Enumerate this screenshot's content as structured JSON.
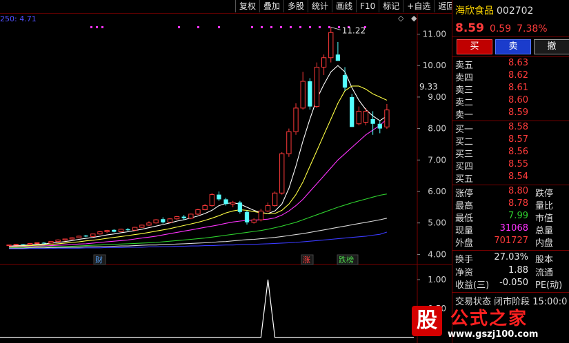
{
  "toolbar": {
    "buttons": [
      "复权",
      "叠加",
      "多股",
      "统计",
      "画线",
      "F10",
      "标记",
      "+自选",
      "返回"
    ]
  },
  "chart": {
    "indicator_label": "250: 4.71",
    "price_axis": [
      "11.00",
      "10.00",
      "9.00",
      "8.00",
      "7.00",
      "6.00",
      "5.00",
      "4.00"
    ],
    "price_axis_values": [
      11,
      10,
      9,
      8,
      7,
      6,
      5,
      4
    ],
    "current_price_tag": "9.33",
    "high_label": "11.22",
    "lower_axis": [
      "1.00",
      "0.50"
    ],
    "event_markers": [
      {
        "text": "财",
        "color": "#5aa8ff"
      },
      {
        "text": "涨",
        "color": "#ff4040"
      },
      {
        "text": "跌榜",
        "color": "#4cd64c"
      }
    ],
    "candles": [
      [
        4.28,
        4.3,
        4.26,
        4.3
      ],
      [
        4.3,
        4.33,
        4.29,
        4.32
      ],
      [
        4.32,
        4.33,
        4.3,
        4.31
      ],
      [
        4.31,
        4.36,
        4.3,
        4.35
      ],
      [
        4.35,
        4.38,
        4.33,
        4.37
      ],
      [
        4.37,
        4.39,
        4.34,
        4.36
      ],
      [
        4.36,
        4.42,
        4.35,
        4.41
      ],
      [
        4.41,
        4.48,
        4.4,
        4.46
      ],
      [
        4.46,
        4.5,
        4.43,
        4.49
      ],
      [
        4.49,
        4.55,
        4.47,
        4.53
      ],
      [
        4.53,
        4.6,
        4.51,
        4.58
      ],
      [
        4.6,
        4.62,
        4.55,
        4.57
      ],
      [
        4.57,
        4.66,
        4.55,
        4.65
      ],
      [
        4.65,
        4.74,
        4.63,
        4.72
      ],
      [
        4.72,
        4.78,
        4.68,
        4.76
      ],
      [
        4.78,
        4.8,
        4.7,
        4.72
      ],
      [
        4.72,
        4.82,
        4.71,
        4.8
      ],
      [
        4.8,
        4.84,
        4.74,
        4.77
      ],
      [
        4.77,
        4.88,
        4.76,
        4.86
      ],
      [
        4.86,
        4.95,
        4.84,
        4.93
      ],
      [
        4.93,
        5.05,
        4.9,
        5.0
      ],
      [
        5.0,
        5.12,
        4.98,
        5.1
      ],
      [
        5.12,
        5.18,
        4.98,
        5.02
      ],
      [
        5.02,
        5.15,
        5.0,
        5.13
      ],
      [
        5.13,
        5.22,
        5.1,
        5.2
      ],
      [
        5.2,
        5.25,
        5.1,
        5.15
      ],
      [
        5.15,
        5.3,
        5.12,
        5.28
      ],
      [
        5.28,
        5.45,
        5.25,
        5.42
      ],
      [
        5.42,
        5.6,
        5.4,
        5.55
      ],
      [
        5.55,
        5.95,
        5.52,
        5.9
      ],
      [
        5.9,
        6.0,
        5.7,
        5.75
      ],
      [
        5.75,
        5.8,
        5.55,
        5.6
      ],
      [
        5.6,
        5.7,
        5.5,
        5.65
      ],
      [
        5.65,
        5.7,
        5.3,
        5.35
      ],
      [
        5.35,
        5.4,
        4.95,
        5.02
      ],
      [
        5.02,
        5.15,
        4.98,
        5.1
      ],
      [
        5.1,
        5.45,
        5.05,
        5.38
      ],
      [
        5.38,
        5.65,
        5.35,
        5.55
      ],
      [
        5.55,
        6.0,
        5.52,
        5.95
      ],
      [
        5.95,
        7.25,
        5.9,
        7.2
      ],
      [
        7.2,
        8.0,
        7.1,
        7.9
      ],
      [
        7.9,
        8.8,
        7.8,
        8.65
      ],
      [
        8.65,
        9.8,
        8.6,
        9.5
      ],
      [
        9.5,
        9.6,
        8.6,
        8.7
      ],
      [
        8.7,
        10.1,
        8.65,
        9.95
      ],
      [
        9.95,
        10.35,
        9.7,
        10.25
      ],
      [
        10.25,
        11.22,
        10.1,
        11.05
      ],
      [
        10.35,
        10.75,
        10.15,
        10.15
      ],
      [
        9.7,
        9.95,
        9.2,
        9.3
      ],
      [
        9.0,
        9.1,
        8.05,
        8.05
      ],
      [
        8.15,
        8.7,
        8.1,
        8.55
      ],
      [
        8.2,
        8.65,
        8.1,
        8.55
      ],
      [
        8.3,
        8.55,
        7.8,
        8.15
      ],
      [
        8.15,
        8.25,
        7.85,
        8.0
      ],
      [
        8.05,
        8.78,
        7.99,
        8.59
      ]
    ],
    "ma_series": [
      {
        "color": "#ffffff",
        "values": [
          4.26,
          4.28,
          4.29,
          4.3,
          4.32,
          4.33,
          4.36,
          4.38,
          4.41,
          4.44,
          4.48,
          4.51,
          4.54,
          4.58,
          4.62,
          4.65,
          4.69,
          4.72,
          4.76,
          4.8,
          4.85,
          4.9,
          4.95,
          5.0,
          5.06,
          5.1,
          5.16,
          5.22,
          5.3,
          5.4,
          5.55,
          5.62,
          5.64,
          5.6,
          5.5,
          5.4,
          5.33,
          5.3,
          5.38,
          5.6,
          6.1,
          6.8,
          7.6,
          8.3,
          8.95,
          9.4,
          9.8,
          10.0,
          9.8,
          9.3,
          8.9,
          8.6,
          8.4,
          8.25,
          8.4
        ]
      },
      {
        "color": "#ffff44",
        "values": [
          4.25,
          4.26,
          4.27,
          4.28,
          4.29,
          4.3,
          4.32,
          4.34,
          4.36,
          4.38,
          4.4,
          4.43,
          4.45,
          4.48,
          4.51,
          4.54,
          4.57,
          4.6,
          4.63,
          4.66,
          4.7,
          4.74,
          4.78,
          4.82,
          4.87,
          4.92,
          4.97,
          5.02,
          5.08,
          5.15,
          5.23,
          5.32,
          5.38,
          5.42,
          5.4,
          5.36,
          5.32,
          5.3,
          5.3,
          5.4,
          5.6,
          5.9,
          6.3,
          6.8,
          7.3,
          7.8,
          8.3,
          8.8,
          9.2,
          9.35,
          9.35,
          9.25,
          9.1,
          9.0,
          8.9
        ]
      },
      {
        "color": "#ff33ff",
        "values": [
          4.24,
          4.24,
          4.25,
          4.25,
          4.26,
          4.27,
          4.28,
          4.29,
          4.3,
          4.31,
          4.33,
          4.34,
          4.36,
          4.38,
          4.4,
          4.42,
          4.44,
          4.46,
          4.49,
          4.52,
          4.55,
          4.58,
          4.62,
          4.66,
          4.7,
          4.74,
          4.78,
          4.82,
          4.86,
          4.9,
          4.94,
          4.99,
          5.03,
          5.06,
          5.08,
          5.09,
          5.1,
          5.12,
          5.16,
          5.25,
          5.38,
          5.55,
          5.75,
          6.0,
          6.25,
          6.5,
          6.75,
          7.0,
          7.2,
          7.4,
          7.6,
          7.8,
          7.95,
          8.1,
          8.3
        ]
      },
      {
        "color": "#2ed02e",
        "values": [
          4.22,
          4.22,
          4.23,
          4.23,
          4.24,
          4.24,
          4.25,
          4.25,
          4.26,
          4.26,
          4.27,
          4.28,
          4.29,
          4.3,
          4.31,
          4.32,
          4.33,
          4.34,
          4.35,
          4.36,
          4.37,
          4.38,
          4.4,
          4.42,
          4.44,
          4.46,
          4.48,
          4.5,
          4.52,
          4.55,
          4.58,
          4.61,
          4.64,
          4.67,
          4.7,
          4.73,
          4.76,
          4.8,
          4.85,
          4.9,
          4.96,
          5.02,
          5.1,
          5.18,
          5.26,
          5.34,
          5.42,
          5.5,
          5.57,
          5.64,
          5.7,
          5.76,
          5.82,
          5.88,
          5.92
        ]
      },
      {
        "color": "#d8d8d8",
        "values": [
          4.2,
          4.2,
          4.2,
          4.21,
          4.21,
          4.21,
          4.22,
          4.22,
          4.22,
          4.23,
          4.23,
          4.24,
          4.24,
          4.25,
          4.25,
          4.26,
          4.27,
          4.27,
          4.28,
          4.29,
          4.3,
          4.3,
          4.31,
          4.32,
          4.33,
          4.34,
          4.35,
          4.36,
          4.37,
          4.38,
          4.4,
          4.41,
          4.43,
          4.45,
          4.47,
          4.48,
          4.5,
          4.52,
          4.54,
          4.57,
          4.6,
          4.63,
          4.66,
          4.7,
          4.74,
          4.78,
          4.82,
          4.86,
          4.9,
          4.94,
          4.98,
          5.02,
          5.06,
          5.1,
          5.15
        ]
      },
      {
        "color": "#3a3aff",
        "values": [
          4.18,
          4.18,
          4.18,
          4.19,
          4.19,
          4.19,
          4.19,
          4.2,
          4.2,
          4.2,
          4.2,
          4.21,
          4.21,
          4.21,
          4.22,
          4.22,
          4.22,
          4.23,
          4.23,
          4.23,
          4.24,
          4.24,
          4.25,
          4.25,
          4.26,
          4.26,
          4.27,
          4.27,
          4.28,
          4.28,
          4.29,
          4.3,
          4.3,
          4.31,
          4.32,
          4.32,
          4.33,
          4.34,
          4.35,
          4.36,
          4.37,
          4.38,
          4.4,
          4.42,
          4.44,
          4.46,
          4.48,
          4.5,
          4.52,
          4.54,
          4.56,
          4.58,
          4.61,
          4.64,
          4.71
        ]
      }
    ],
    "indicator_values": [
      0,
      0,
      0,
      0,
      0,
      0,
      0,
      0,
      0,
      0,
      0,
      0,
      0,
      0,
      0,
      0,
      0,
      0,
      0,
      0,
      0,
      0,
      0,
      0,
      0,
      0,
      0,
      0,
      0,
      0,
      0,
      0,
      0,
      0,
      0,
      0,
      0,
      1,
      0,
      0,
      0,
      0,
      0,
      0,
      0,
      0,
      0,
      0,
      0,
      0,
      0,
      0,
      0,
      0,
      0
    ]
  },
  "quote": {
    "name": "海欣食品",
    "code": "002702",
    "price": "8.59",
    "change": "0.59",
    "change_pct": "7.38%",
    "buttons": {
      "buy": "买",
      "sell": "卖",
      "cancel": "撤"
    },
    "asks": [
      {
        "label": "卖五",
        "price": "8.63"
      },
      {
        "label": "卖四",
        "price": "8.62"
      },
      {
        "label": "卖三",
        "price": "8.61"
      },
      {
        "label": "卖二",
        "price": "8.60"
      },
      {
        "label": "卖一",
        "price": "8.59"
      }
    ],
    "bids": [
      {
        "label": "买一",
        "price": "8.58"
      },
      {
        "label": "买二",
        "price": "8.57"
      },
      {
        "label": "买三",
        "price": "8.56"
      },
      {
        "label": "买四",
        "price": "8.55"
      },
      {
        "label": "买五",
        "price": "8.54"
      }
    ],
    "stats": [
      {
        "l1": "涨停",
        "v1": "8.80",
        "c1": "red",
        "l2": "跌停"
      },
      {
        "l1": "最高",
        "v1": "8.78",
        "c1": "red",
        "l2": "量比"
      },
      {
        "l1": "最低",
        "v1": "7.99",
        "c1": "green",
        "l2": "市值"
      },
      {
        "l1": "现量",
        "v1": "31068",
        "c1": "mag",
        "l2": "总量"
      },
      {
        "l1": "外盘",
        "v1": "701727",
        "c1": "red",
        "l2": "内盘"
      }
    ],
    "stats2": [
      {
        "l1": "换手",
        "v1": "27.03%",
        "c1": "white",
        "l2": "股本"
      },
      {
        "l1": "净资",
        "v1": "1.88",
        "c1": "white",
        "l2": "流通"
      },
      {
        "l1": "收益(三)",
        "v1": "-0.050",
        "c1": "white",
        "l2": "PE(动)"
      }
    ],
    "footer_partial": "交易状态 闭市阶段 15:00:0"
  },
  "watermark": {
    "badge": "股",
    "name": "公式之家",
    "url": "www.gszj100.com"
  }
}
